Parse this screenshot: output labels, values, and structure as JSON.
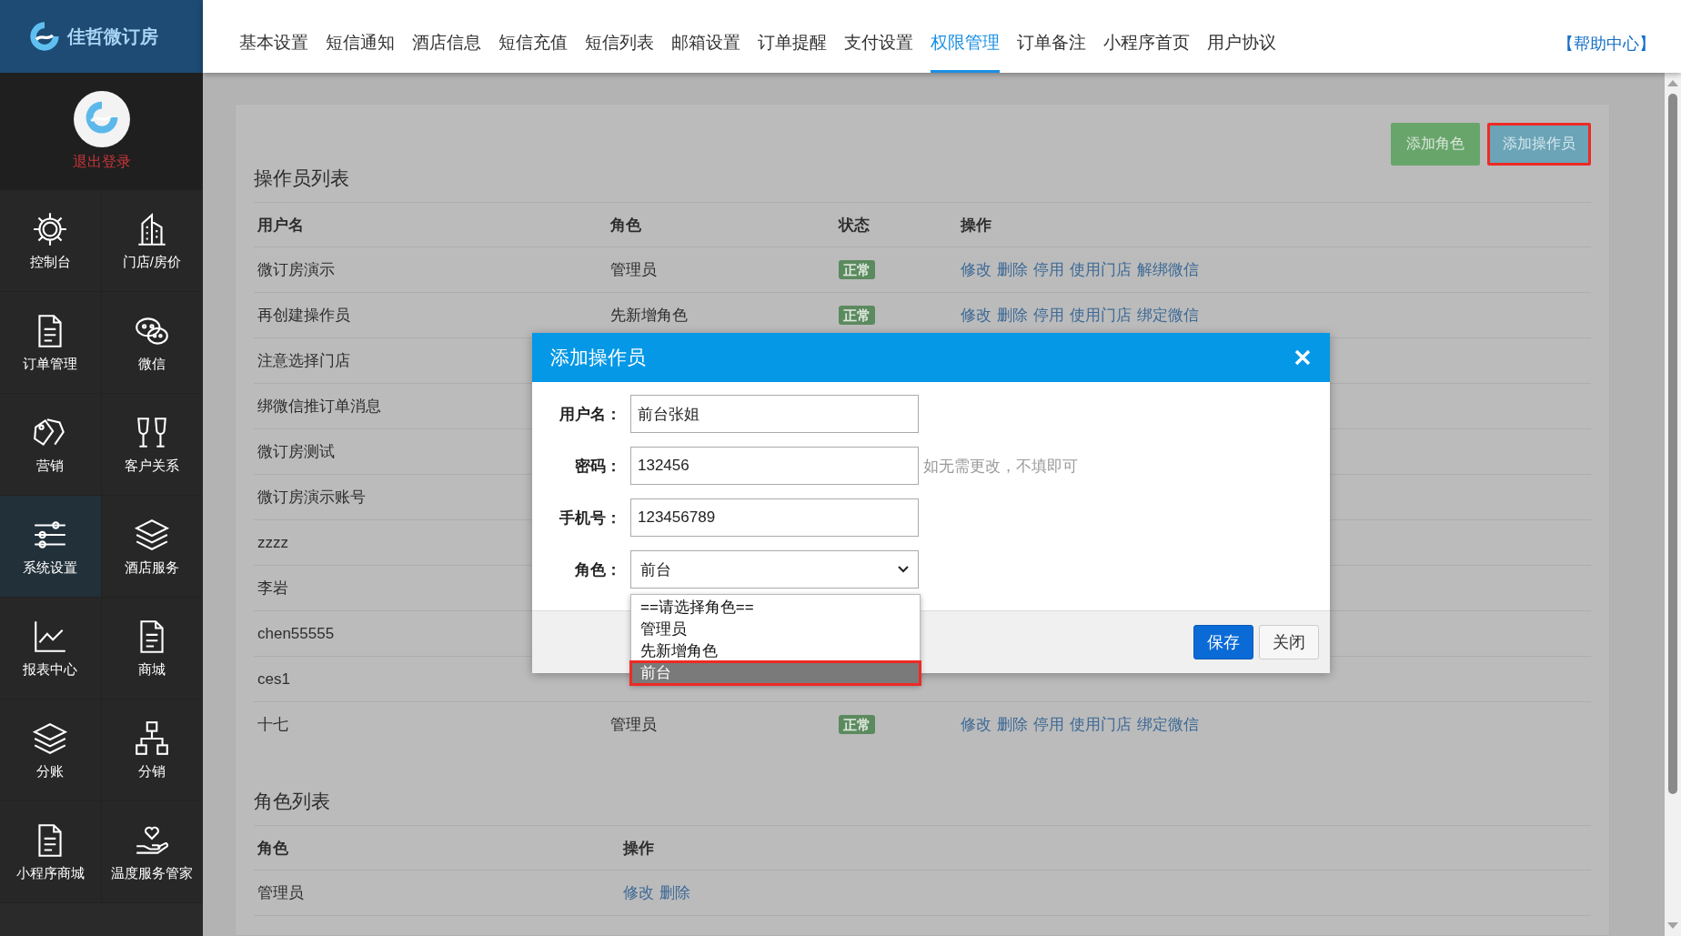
{
  "brand": {
    "name": "佳哲微订房"
  },
  "profile": {
    "logout": "退出登录"
  },
  "sidebar": {
    "items": [
      {
        "label": "控制台",
        "selected": false
      },
      {
        "label": "门店/房价",
        "selected": false
      },
      {
        "label": "订单管理",
        "selected": false
      },
      {
        "label": "微信",
        "selected": false
      },
      {
        "label": "营销",
        "selected": false
      },
      {
        "label": "客户关系",
        "selected": false
      },
      {
        "label": "系统设置",
        "selected": true
      },
      {
        "label": "酒店服务",
        "selected": false
      },
      {
        "label": "报表中心",
        "selected": false
      },
      {
        "label": "商城",
        "selected": false
      },
      {
        "label": "分账",
        "selected": false
      },
      {
        "label": "分销",
        "selected": false
      },
      {
        "label": "小程序商城",
        "selected": false
      },
      {
        "label": "温度服务管家",
        "selected": false
      }
    ]
  },
  "nav": {
    "tabs": [
      {
        "label": "基本设置",
        "selected": false
      },
      {
        "label": "短信通知",
        "selected": false
      },
      {
        "label": "酒店信息",
        "selected": false
      },
      {
        "label": "短信充值",
        "selected": false
      },
      {
        "label": "短信列表",
        "selected": false
      },
      {
        "label": "邮箱设置",
        "selected": false
      },
      {
        "label": "订单提醒",
        "selected": false
      },
      {
        "label": "支付设置",
        "selected": false
      },
      {
        "label": "权限管理",
        "selected": true
      },
      {
        "label": "订单备注",
        "selected": false
      },
      {
        "label": "小程序首页",
        "selected": false
      },
      {
        "label": "用户协议",
        "selected": false
      }
    ],
    "help": "【帮助中心】"
  },
  "operators": {
    "title": "操作员列表",
    "buttons": [
      {
        "label": "添加角色",
        "kind": "role",
        "highlighted": false
      },
      {
        "label": "添加操作员",
        "kind": "operator",
        "highlighted": true
      }
    ],
    "columns": [
      "用户名",
      "角色",
      "状态",
      "操作"
    ],
    "rows": [
      {
        "username": "微订房演示",
        "role": "管理员",
        "status": "正常",
        "actions": [
          "修改",
          "删除",
          "停用",
          "使用门店",
          "解绑微信"
        ]
      },
      {
        "username": "再创建操作员",
        "role": "先新增角色",
        "status": "正常",
        "actions": [
          "修改",
          "删除",
          "停用",
          "使用门店",
          "绑定微信"
        ]
      },
      {
        "username": "注意选择门店"
      },
      {
        "username": "绑微信推订单消息"
      },
      {
        "username": "微订房测试"
      },
      {
        "username": "微订房演示账号"
      },
      {
        "username": "zzzz"
      },
      {
        "username": "李岩"
      },
      {
        "username": "chen55555"
      },
      {
        "username": "ces1"
      },
      {
        "username": "十七",
        "role": "管理员",
        "status": "正常",
        "actions": [
          "修改",
          "删除",
          "停用",
          "使用门店",
          "绑定微信"
        ]
      }
    ]
  },
  "roles": {
    "title": "角色列表",
    "columns": [
      "角色",
      "操作"
    ],
    "rows": [
      {
        "role": "管理员",
        "actions": [
          "修改",
          "删除"
        ]
      }
    ]
  },
  "dialog": {
    "title": "添加操作员",
    "fields": [
      {
        "kind": "text",
        "label": "用户名：",
        "value": "前台张姐"
      },
      {
        "kind": "text",
        "label": "密码：",
        "value": "132456",
        "hint": "如无需更改，不填即可"
      },
      {
        "kind": "text",
        "label": "手机号：",
        "value": "123456789"
      },
      {
        "kind": "select",
        "label": "角色：",
        "value": "前台",
        "options": [
          {
            "label": "==请选择角色==",
            "selected": false,
            "highlighted": false
          },
          {
            "label": "管理员",
            "selected": false,
            "highlighted": false
          },
          {
            "label": "先新增角色",
            "selected": false,
            "highlighted": false
          },
          {
            "label": "前台",
            "selected": true,
            "highlighted": true
          }
        ]
      }
    ],
    "buttons": [
      {
        "label": "保存",
        "kind": "primary"
      },
      {
        "label": "关闭",
        "kind": "default"
      }
    ]
  }
}
